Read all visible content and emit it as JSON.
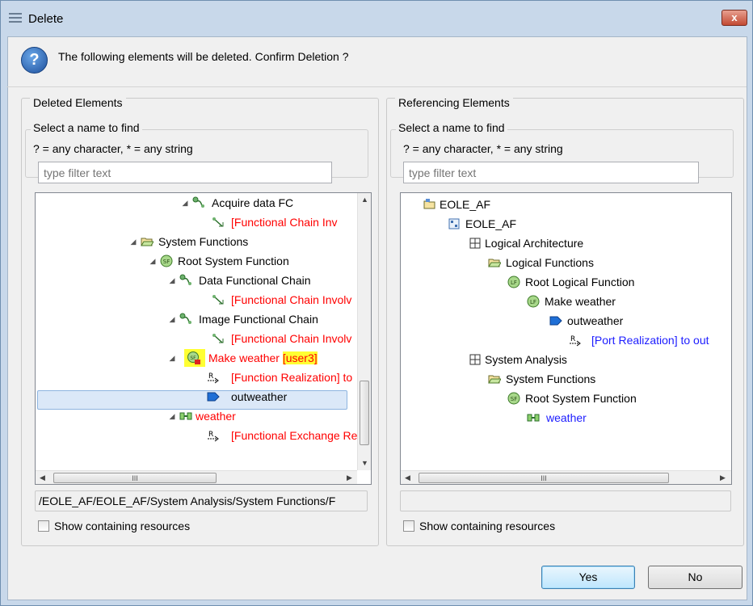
{
  "window": {
    "title": "Delete",
    "close_label": "x"
  },
  "message": "The following elements will be deleted. Confirm Deletion ?",
  "left": {
    "group_label": "Deleted Elements",
    "find_label": "Select a name to find",
    "hint": "? = any character, * = any string",
    "filter_placeholder": "type filter text",
    "path": "/EOLE_AF/EOLE_AF/System Analysis/System Functions/F",
    "show_resources": "Show containing resources",
    "scroll_thumb": "III",
    "tree": [
      {
        "label": "Acquire data FC",
        "color": "black"
      },
      {
        "label": "[Functional Chain Inv",
        "color": "red"
      },
      {
        "label": "System Functions",
        "color": "black"
      },
      {
        "label": "Root System Function",
        "color": "black"
      },
      {
        "label": "Data Functional Chain",
        "color": "black"
      },
      {
        "label": "[Functional Chain Involv",
        "color": "red"
      },
      {
        "label": "Image Functional Chain",
        "color": "black"
      },
      {
        "label": "[Functional Chain Involv",
        "color": "red"
      },
      {
        "label": "Make weather ",
        "suffix": "[user3]",
        "color": "red"
      },
      {
        "label": "[Function Realization] to",
        "color": "red"
      },
      {
        "label": "outweather",
        "color": "black"
      },
      {
        "label": "weather",
        "color": "red"
      },
      {
        "label": "[Functional Exchange Re",
        "color": "red"
      }
    ]
  },
  "right": {
    "group_label": "Referencing Elements",
    "find_label": "Select a name to find",
    "hint": "? = any character, * = any string",
    "filter_placeholder": "type filter text",
    "path": "",
    "show_resources": "Show containing resources",
    "scroll_thumb": "III",
    "tree": [
      {
        "label": "EOLE_AF",
        "color": "black"
      },
      {
        "label": "EOLE_AF",
        "color": "black"
      },
      {
        "label": "Logical Architecture",
        "color": "black"
      },
      {
        "label": "Logical Functions",
        "color": "black"
      },
      {
        "label": "Root Logical Function",
        "color": "black"
      },
      {
        "label": "Make weather",
        "color": "black"
      },
      {
        "label": "outweather",
        "color": "black"
      },
      {
        "label": "[Port Realization] to out",
        "color": "blue"
      },
      {
        "label": "System Analysis",
        "color": "black"
      },
      {
        "label": "System Functions",
        "color": "black"
      },
      {
        "label": "Root System Function",
        "color": "black"
      },
      {
        "label": "weather",
        "color": "blue"
      }
    ]
  },
  "buttons": {
    "yes": "Yes",
    "no": "No"
  },
  "colors": {
    "red": "#ff0000",
    "blue": "#1c1cff",
    "highlight": "#ffff33",
    "selection": "#dbe8f8"
  }
}
